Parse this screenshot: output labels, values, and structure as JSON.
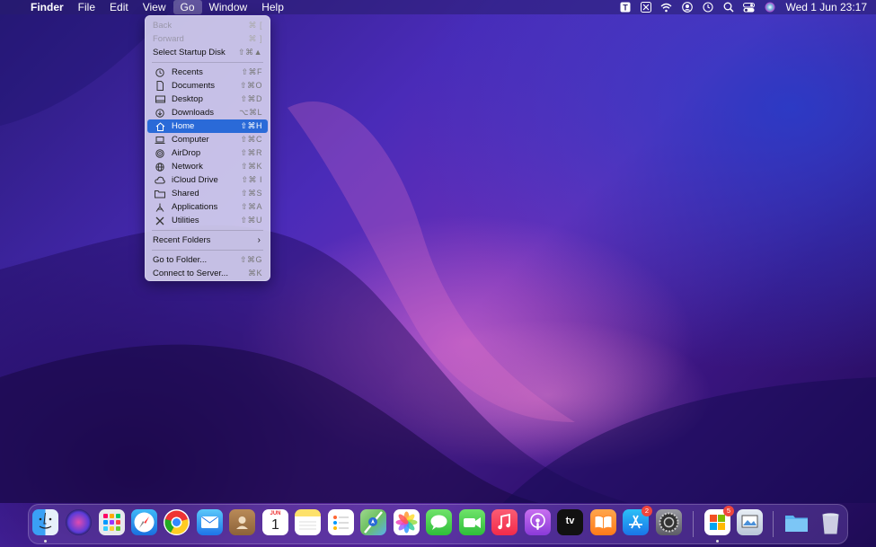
{
  "menubar": {
    "app_name": "Finder",
    "menus": [
      "File",
      "Edit",
      "View",
      "Go",
      "Window",
      "Help"
    ],
    "clock": "Wed 1 Jun  23:17"
  },
  "go_menu": {
    "items": [
      {
        "label": "Back",
        "shortcut": "⌘ [",
        "disabled": true
      },
      {
        "label": "Forward",
        "shortcut": "⌘ ]",
        "disabled": true
      },
      {
        "label": "Select Startup Disk",
        "shortcut": "⇧⌘▲"
      },
      {
        "label": "Recents",
        "shortcut": "⇧⌘F",
        "icon": "clock-icon"
      },
      {
        "label": "Documents",
        "shortcut": "⇧⌘O",
        "icon": "document-icon"
      },
      {
        "label": "Desktop",
        "shortcut": "⇧⌘D",
        "icon": "desktop-icon"
      },
      {
        "label": "Downloads",
        "shortcut": "⌥⌘L",
        "icon": "download-icon"
      },
      {
        "label": "Home",
        "shortcut": "⇧⌘H",
        "icon": "home-icon",
        "selected": true
      },
      {
        "label": "Computer",
        "shortcut": "⇧⌘C",
        "icon": "laptop-icon"
      },
      {
        "label": "AirDrop",
        "shortcut": "⇧⌘R",
        "icon": "airdrop-icon"
      },
      {
        "label": "Network",
        "shortcut": "⇧⌘K",
        "icon": "globe-icon"
      },
      {
        "label": "iCloud Drive",
        "shortcut": "⇧⌘ I",
        "icon": "cloud-icon"
      },
      {
        "label": "Shared",
        "shortcut": "⇧⌘S",
        "icon": "shared-folder-icon"
      },
      {
        "label": "Applications",
        "shortcut": "⇧⌘A",
        "icon": "applications-icon"
      },
      {
        "label": "Utilities",
        "shortcut": "⇧⌘U",
        "icon": "utilities-icon"
      },
      {
        "label": "Recent Folders"
      },
      {
        "label": "Go to Folder...",
        "shortcut": "⇧⌘G"
      },
      {
        "label": "Connect to Server...",
        "shortcut": "⌘K"
      }
    ]
  },
  "dock": {
    "calendar_month": "JUN",
    "calendar_day": "1",
    "appstore_badge": "2",
    "extra_badge": "5",
    "tv_label": "tv"
  }
}
